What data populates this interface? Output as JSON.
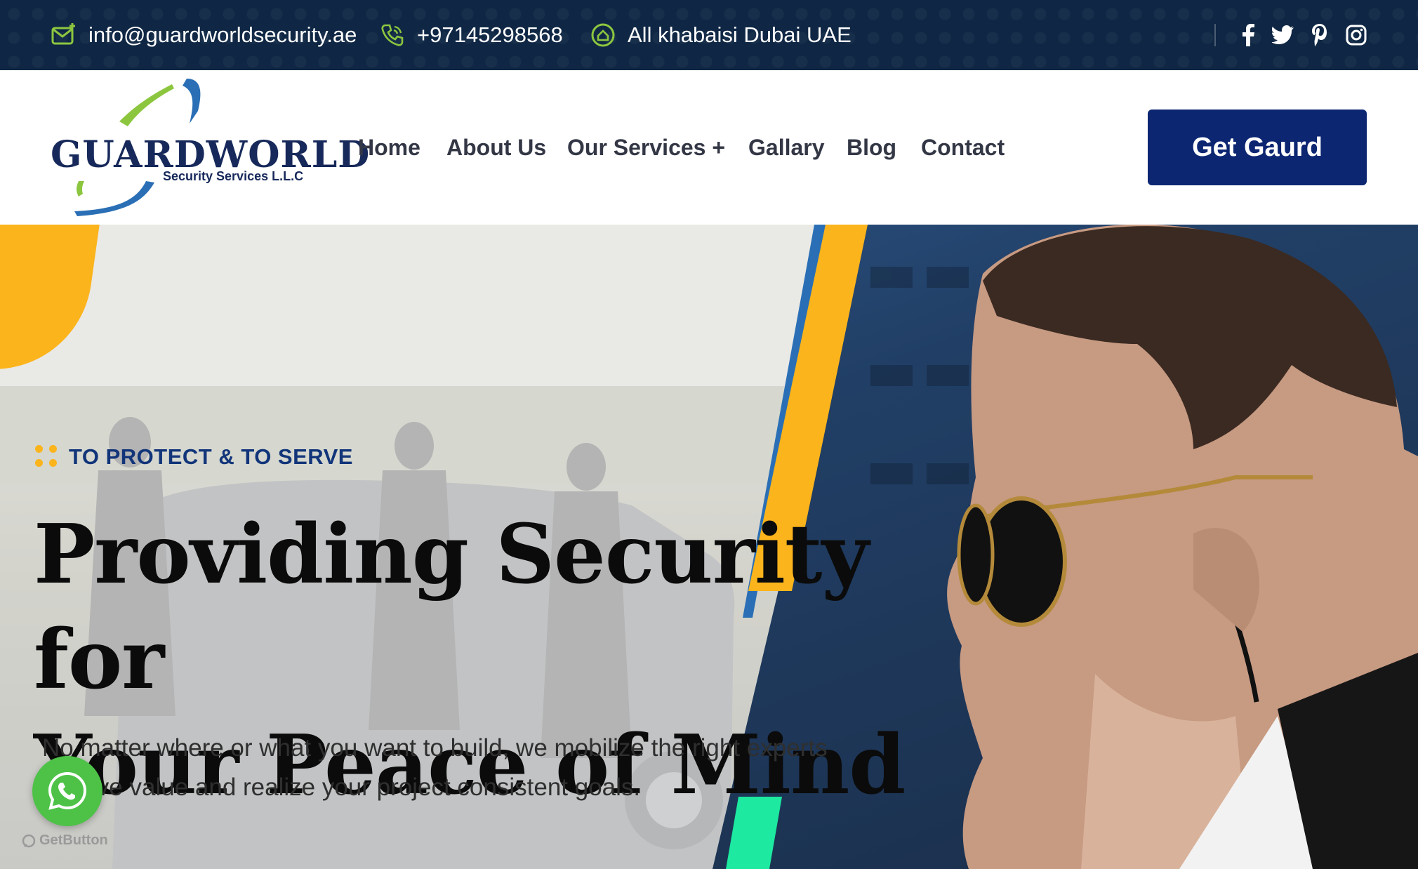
{
  "topbar": {
    "email": "info@guardworldsecurity.ae",
    "phone": "+97145298568",
    "address": "All khabaisi Dubai UAE",
    "social_icons": [
      "facebook-icon",
      "twitter-icon",
      "pinterest-icon",
      "instagram-icon"
    ]
  },
  "header": {
    "logo_word": "GUARDWORLD",
    "logo_sub": "Security Services L.L.C",
    "nav": {
      "home": "Home",
      "about": "About Us",
      "services": "Our Services +",
      "gallery": "Gallary",
      "blog": "Blog",
      "contact": "Contact"
    },
    "cta_label": "Get Gaurd"
  },
  "hero": {
    "tagline": "TO PROTECT & TO SERVE",
    "headline_line1": "Providing Security for",
    "headline_line2": "Your Peace of Mind",
    "subtext_line1": "No matter where or what you want to build, we mobilize the right experts",
    "subtext_line2": "to drive value and realize your project consistent goals."
  },
  "widgets": {
    "whatsapp_icon": "whatsapp-icon",
    "getbutton_label": "GetButton"
  },
  "colors": {
    "topbar": "#0f2744",
    "brand_navy": "#0c2672",
    "accent_yellow": "#fbb41c",
    "accent_green": "#8cc63f",
    "accent_blue": "#2a6fb5",
    "tagline_blue": "#12357a",
    "whatsapp_green": "#4dc247"
  }
}
